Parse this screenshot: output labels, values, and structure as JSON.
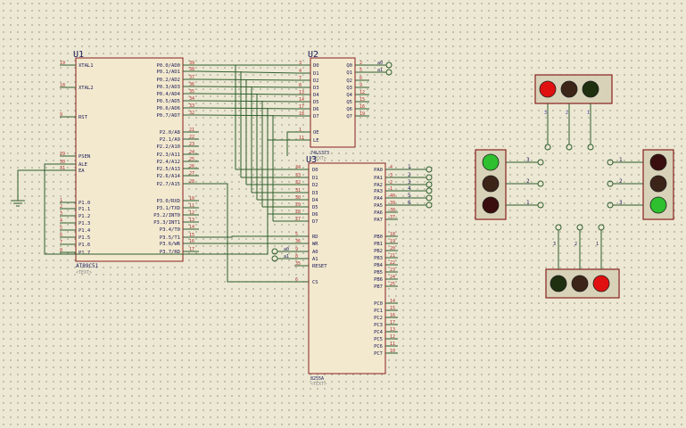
{
  "u1": {
    "ref": "U1",
    "part": "AT89C51",
    "sub": "<TEXT>",
    "left_pins": [
      {
        "num": "19",
        "name": "XTAL1"
      },
      {
        "num": "18",
        "name": "XTAL2"
      },
      {
        "num": "9",
        "name": "RST"
      },
      {
        "num": "29",
        "name": "PSEN"
      },
      {
        "num": "30",
        "name": "ALE"
      },
      {
        "num": "31",
        "name": "EA"
      },
      {
        "num": "1",
        "name": "P1.0"
      },
      {
        "num": "2",
        "name": "P1.1"
      },
      {
        "num": "3",
        "name": "P1.2"
      },
      {
        "num": "4",
        "name": "P1.3"
      },
      {
        "num": "5",
        "name": "P1.4"
      },
      {
        "num": "6",
        "name": "P1.5"
      },
      {
        "num": "7",
        "name": "P1.6"
      },
      {
        "num": "8",
        "name": "P1.7"
      }
    ],
    "right_pins": [
      {
        "num": "39",
        "name": "P0.0/AD0"
      },
      {
        "num": "38",
        "name": "P0.1/AD1"
      },
      {
        "num": "37",
        "name": "P0.2/AD2"
      },
      {
        "num": "36",
        "name": "P0.3/AD3"
      },
      {
        "num": "35",
        "name": "P0.4/AD4"
      },
      {
        "num": "34",
        "name": "P0.5/AD5"
      },
      {
        "num": "33",
        "name": "P0.6/AD6"
      },
      {
        "num": "32",
        "name": "P0.7/AD7"
      },
      {
        "num": "21",
        "name": "P2.0/A8"
      },
      {
        "num": "22",
        "name": "P2.1/A9"
      },
      {
        "num": "23",
        "name": "P2.2/A10"
      },
      {
        "num": "24",
        "name": "P2.3/A11"
      },
      {
        "num": "25",
        "name": "P2.4/A12"
      },
      {
        "num": "26",
        "name": "P2.5/A13"
      },
      {
        "num": "27",
        "name": "P2.6/A14"
      },
      {
        "num": "28",
        "name": "P2.7/A15"
      },
      {
        "num": "10",
        "name": "P3.0/RXD"
      },
      {
        "num": "11",
        "name": "P3.1/TXD"
      },
      {
        "num": "12",
        "name": "P3.2/INT0"
      },
      {
        "num": "13",
        "name": "P3.3/INT1"
      },
      {
        "num": "14",
        "name": "P3.4/T0"
      },
      {
        "num": "15",
        "name": "P3.5/T1"
      },
      {
        "num": "16",
        "name": "P3.6/WR"
      },
      {
        "num": "17",
        "name": "P3.7/RD"
      }
    ]
  },
  "u2": {
    "ref": "U2",
    "part": "74LS373",
    "sub": "<TEXT>",
    "left_pins": [
      {
        "num": "3",
        "name": "D0"
      },
      {
        "num": "4",
        "name": "D1"
      },
      {
        "num": "7",
        "name": "D2"
      },
      {
        "num": "8",
        "name": "D3"
      },
      {
        "num": "13",
        "name": "D4"
      },
      {
        "num": "14",
        "name": "D5"
      },
      {
        "num": "17",
        "name": "D6"
      },
      {
        "num": "18",
        "name": "D7"
      },
      {
        "num": "1",
        "name": "OE"
      },
      {
        "num": "11",
        "name": "LE"
      }
    ],
    "right_pins": [
      {
        "num": "2",
        "name": "Q0"
      },
      {
        "num": "5",
        "name": "Q1"
      },
      {
        "num": "6",
        "name": "Q2"
      },
      {
        "num": "9",
        "name": "Q3"
      },
      {
        "num": "12",
        "name": "Q4"
      },
      {
        "num": "15",
        "name": "Q5"
      },
      {
        "num": "16",
        "name": "Q6"
      },
      {
        "num": "19",
        "name": "Q7"
      }
    ],
    "net_q0": "a0",
    "net_q1": "a1"
  },
  "u3": {
    "ref": "U3",
    "part": "8255A",
    "sub": "<TEXT>",
    "left_pins": [
      {
        "num": "34",
        "name": "D0"
      },
      {
        "num": "33",
        "name": "D1"
      },
      {
        "num": "32",
        "name": "D2"
      },
      {
        "num": "31",
        "name": "D3"
      },
      {
        "num": "30",
        "name": "D4"
      },
      {
        "num": "29",
        "name": "D5"
      },
      {
        "num": "28",
        "name": "D6"
      },
      {
        "num": "27",
        "name": "D7"
      },
      {
        "num": "5",
        "name": "RD"
      },
      {
        "num": "36",
        "name": "WR"
      },
      {
        "num": "9",
        "name": "A0"
      },
      {
        "num": "8",
        "name": "A1"
      },
      {
        "num": "35",
        "name": "RESET"
      },
      {
        "num": "6",
        "name": "CS"
      }
    ],
    "right_pins": [
      {
        "num": "4",
        "name": "PA0"
      },
      {
        "num": "3",
        "name": "PA1"
      },
      {
        "num": "2",
        "name": "PA2"
      },
      {
        "num": "1",
        "name": "PA3"
      },
      {
        "num": "40",
        "name": "PA4"
      },
      {
        "num": "39",
        "name": "PA5"
      },
      {
        "num": "38",
        "name": "PA6"
      },
      {
        "num": "37",
        "name": "PA7"
      },
      {
        "num": "18",
        "name": "PB0"
      },
      {
        "num": "19",
        "name": "PB1"
      },
      {
        "num": "20",
        "name": "PB2"
      },
      {
        "num": "21",
        "name": "PB3"
      },
      {
        "num": "22",
        "name": "PB4"
      },
      {
        "num": "23",
        "name": "PB5"
      },
      {
        "num": "24",
        "name": "PB6"
      },
      {
        "num": "25",
        "name": "PB7"
      },
      {
        "num": "14",
        "name": "PC0"
      },
      {
        "num": "15",
        "name": "PC1"
      },
      {
        "num": "16",
        "name": "PC2"
      },
      {
        "num": "17",
        "name": "PC3"
      },
      {
        "num": "13",
        "name": "PC4"
      },
      {
        "num": "12",
        "name": "PC5"
      },
      {
        "num": "11",
        "name": "PC6"
      },
      {
        "num": "10",
        "name": "PC7"
      }
    ],
    "net_a0": "a0",
    "net_a1": "a1",
    "pa_nets": [
      "1",
      "2",
      "3",
      "4",
      "5",
      "6"
    ]
  },
  "traffic_lights": {
    "north": {
      "lamps": [
        "#e01010",
        "#3c2418",
        "#1e3010"
      ],
      "pins": [
        "3",
        "2",
        "1"
      ]
    },
    "west": {
      "lamps": [
        "#2ec02e",
        "#3c2418",
        "#3a0e0e"
      ],
      "pins": [
        "3",
        "2",
        "1"
      ]
    },
    "east": {
      "lamps": [
        "#3a0e0e",
        "#3c2418",
        "#2ec02e"
      ],
      "pins": [
        "1",
        "2",
        "3"
      ]
    },
    "south": {
      "lamps": [
        "#1e3010",
        "#3c2418",
        "#e01010"
      ],
      "pins": [
        "3",
        "2",
        "1"
      ]
    }
  },
  "colors": {
    "wire": "#2e5e2e",
    "chip_border": "#8a2020",
    "chip_fill": "#f3e9ce"
  }
}
